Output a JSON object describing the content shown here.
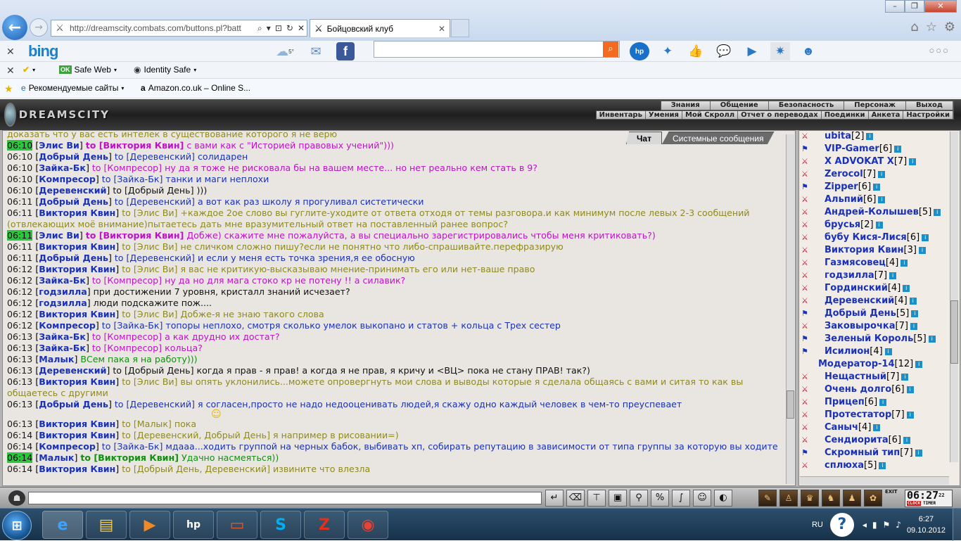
{
  "browser": {
    "url": "http://dreamscity.combats.com/buttons.pl?batt",
    "tab_title": "Бойцовский клуб",
    "window_buttons": [
      "–",
      "❐",
      "✕"
    ],
    "bing_logo": "bing",
    "weather_temp": "5°",
    "hp_label": "hp",
    "safe_web": "Safe Web",
    "identity_safe": "Identity Safe",
    "fav_recommended": "Рекомендуемые сайты",
    "fav_amazon": "Amazon.co.uk – Online S...",
    "search_placeholder": ""
  },
  "game": {
    "logo": "DREAMSCITY",
    "menu_top": [
      "Знания",
      "Общение",
      "Безопасность",
      "Персонаж",
      "Выход"
    ],
    "menu_bottom": [
      "Инвентарь",
      "Умения",
      "Мой Скролл",
      "Отчет о переводах",
      "Поединки",
      "Анкета",
      "Настройки"
    ],
    "tab_chat": "Чат",
    "tab_system": "Системные сообщения",
    "exit_label": "EXIT",
    "clock_time": "06:27",
    "clock_seconds": "22",
    "clock_label": "CLOCK",
    "timer_label": "TIMER"
  },
  "chat": [
    {
      "time": "",
      "from": "",
      "to": "",
      "text": "доказать что у вас есть интелек в существование которого я не верю",
      "cls": "olive",
      "private": false
    },
    {
      "time": "06:10",
      "from": "Элис Ви",
      "to": "to [Виктория Квин]",
      "text": "с вами как с \"Историей правовых учений\")))",
      "cls": "pink",
      "private": true,
      "hl": true
    },
    {
      "time": "06:10",
      "from": "Добрый День",
      "to": "to [Деревенский]",
      "text": "солидарен",
      "cls": "blue",
      "private": false
    },
    {
      "time": "06:10",
      "from": "Зайка-Бк",
      "to": "to [Компресор]",
      "text": "ну да я тоже не рисковала бы на вашем месте... но нет реально кем стать в 9?",
      "cls": "pink",
      "private": false
    },
    {
      "time": "06:10",
      "from": "Компресор",
      "to": "to [Зайка-Бк]",
      "text": "танки и маги неплохи",
      "cls": "blue",
      "private": false
    },
    {
      "time": "06:10",
      "from": "Деревенский",
      "to": "to [Добрый День]",
      "text": ")))",
      "cls": "black",
      "private": false
    },
    {
      "time": "06:11",
      "from": "Добрый День",
      "to": "to [Деревенский]",
      "text": "а вот как раз школу я прогуливал систетически",
      "cls": "blue",
      "private": false
    },
    {
      "time": "06:11",
      "from": "Виктория Квин",
      "to": "to [Элис Ви]",
      "text": "+каждое 2ое слово вы гуглите-уходите от ответа отходя от темы разговора.и как минимум после левых 2-3 сообщений (отвлекающих моё внимание)пытаетесь дать мне вразумительный ответ на поставленный ранее вопрос?",
      "cls": "olive",
      "private": false
    },
    {
      "time": "06:11",
      "from": "Элис Ви",
      "to": "to [Виктория Квин]",
      "text": "Добже) скажите мне пожалуйста, а вы специально зарегистрировались чтобы меня критиковать?)",
      "cls": "pink",
      "private": true,
      "hl": true
    },
    {
      "time": "06:11",
      "from": "Виктория Квин",
      "to": "to [Элис Ви]",
      "text": "не сличком сложно пишу?если не понятно что либо-спрашивайте.перефразирую",
      "cls": "olive",
      "private": false
    },
    {
      "time": "06:11",
      "from": "Добрый День",
      "to": "to [Деревенский]",
      "text": "и если у меня есть точка зрения,я ее обосную",
      "cls": "blue",
      "private": false
    },
    {
      "time": "06:12",
      "from": "Виктория Квин",
      "to": "to [Элис Ви]",
      "text": "я вас не критикую-высказываю мнение-принимать его или нет-ваше право",
      "cls": "olive",
      "private": false
    },
    {
      "time": "06:12",
      "from": "Зайка-Бк",
      "to": "to [Компресор]",
      "text": "ну да но для мага стоко кр не потену !! а силавик?",
      "cls": "pink",
      "private": false
    },
    {
      "time": "06:12",
      "from": "годзилла",
      "to": "",
      "text": "при достижении 7 уровня, кристалл знаний исчезает?",
      "cls": "black",
      "private": false
    },
    {
      "time": "06:12",
      "from": "годзилла",
      "to": "",
      "text": "люди подскажите пож....",
      "cls": "black",
      "private": false
    },
    {
      "time": "06:12",
      "from": "Виктория Квин",
      "to": "to [Элис Ви]",
      "text": "Добже-я не знаю такого слова",
      "cls": "olive",
      "private": false
    },
    {
      "time": "06:12",
      "from": "Компресор",
      "to": "to [Зайка-Бк]",
      "text": "топоры неплохо, смотря сколько умелок выкопано и статов + кольца с Трех сестер",
      "cls": "blue",
      "private": false
    },
    {
      "time": "06:13",
      "from": "Зайка-Бк",
      "to": "to [Компресор]",
      "text": "а как друдно их достат?",
      "cls": "pink",
      "private": false
    },
    {
      "time": "06:13",
      "from": "Зайка-Бк",
      "to": "to [Компресор]",
      "text": "кольца?",
      "cls": "pink",
      "private": false
    },
    {
      "time": "06:13",
      "from": "Малык",
      "to": "",
      "text": "ВСем пака я на работу)))",
      "cls": "green",
      "private": false
    },
    {
      "time": "06:13",
      "from": "Деревенский",
      "to": "to [Добрый День]",
      "text": "когда я прав - я прав! а когда я не прав, я кричу и <ВЦ> пока не стану ПРАВ! так?)",
      "cls": "black",
      "private": false
    },
    {
      "time": "06:13",
      "from": "Виктория Квин",
      "to": "to [Элис Ви]",
      "text": "вы опять уклонились...можете опровергнуть мои слова и выводы которые я сделала общаясь с вами и ситая то как вы общаетесь с другими",
      "cls": "olive",
      "private": false
    },
    {
      "time": "06:13",
      "from": "Добрый День",
      "to": "to [Деревенский]",
      "text": "я согласен,просто не надо недооценивать людей,я скажу одно каждый человек в чем-то преуспевает",
      "cls": "blue",
      "private": false,
      "smile": true
    },
    {
      "time": "06:13",
      "from": "Виктория Квин",
      "to": "to [Малык]",
      "text": "пока",
      "cls": "olive",
      "private": false
    },
    {
      "time": "06:14",
      "from": "Виктория Квин",
      "to": "to [Деревенский, Добрый День]",
      "text": "я например в рисовании=)",
      "cls": "olive",
      "private": false
    },
    {
      "time": "06:14",
      "from": "Компресор",
      "to": "to [Зайка-Бк]",
      "text": "мдааа...ходить группой на черных бабок, выбивать хп, собирать репутацию в зависимости от типа группы за которую вы ходите",
      "cls": "blue",
      "private": false
    },
    {
      "time": "06:14",
      "from": "Малык",
      "to": "to [Виктория Квин]",
      "text": "Удачно насмеяться))",
      "cls": "green",
      "private": true,
      "hl": true
    },
    {
      "time": "06:14",
      "from": "Виктория Квин",
      "to": "to [Добрый День, Деревенский]",
      "text": "извините что влезла",
      "cls": "olive",
      "private": false
    }
  ],
  "users": [
    {
      "name": "ubita",
      "level": "[2]"
    },
    {
      "name": "VIP-Gamer",
      "level": "[6]"
    },
    {
      "name": "X ADVOKAT X",
      "level": "[7]"
    },
    {
      "name": "Zerocol",
      "level": "[7]"
    },
    {
      "name": "Zipper",
      "level": "[6]"
    },
    {
      "name": "Альпий",
      "level": "[6]"
    },
    {
      "name": "Андрей-Колышев",
      "level": "[5]"
    },
    {
      "name": "брусья",
      "level": "[2]"
    },
    {
      "name": "бубу Кися-Лися",
      "level": "[6]"
    },
    {
      "name": "Виктория Квин",
      "level": "[3]"
    },
    {
      "name": "Газмясовец",
      "level": "[4]"
    },
    {
      "name": "годзилла",
      "level": "[7]"
    },
    {
      "name": "Гординский",
      "level": "[4]"
    },
    {
      "name": "Деревенский",
      "level": "[4]"
    },
    {
      "name": "Добрый День",
      "level": "[5]"
    },
    {
      "name": "Заковырочка",
      "level": "[7]"
    },
    {
      "name": "Зеленый Король",
      "level": "[5]"
    },
    {
      "name": "Исилион",
      "level": "[4]"
    },
    {
      "name": "Модератор-14",
      "level": "[12]"
    },
    {
      "name": "Нещастный",
      "level": "[7]"
    },
    {
      "name": "Очень долго",
      "level": "[6]"
    },
    {
      "name": "Прицеп",
      "level": "[6]"
    },
    {
      "name": "Протестатор",
      "level": "[7]"
    },
    {
      "name": "Саныч",
      "level": "[4]"
    },
    {
      "name": "Сендиорита",
      "level": "[6]"
    },
    {
      "name": "Скромный тип",
      "level": "[7]"
    },
    {
      "name": "сплюха",
      "level": "[5]"
    }
  ],
  "taskbar": {
    "lang": "RU",
    "time": "6:27",
    "date": "09.10.2012"
  }
}
